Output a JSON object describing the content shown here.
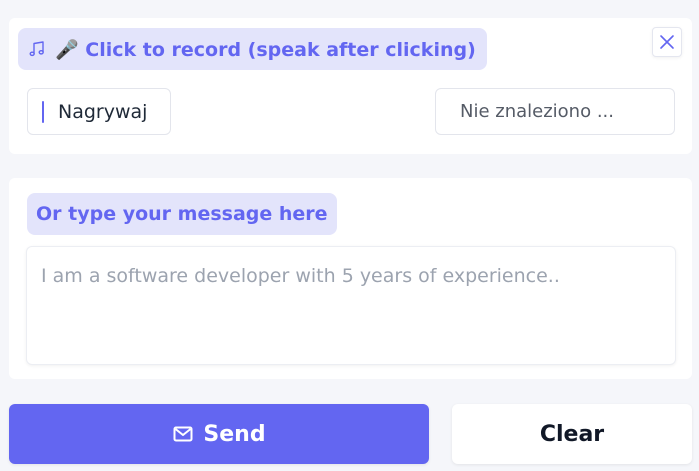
{
  "colors": {
    "accent": "#6366f1",
    "pill_background": "#e3e4fb",
    "page_background": "#f5f6fa",
    "panel_background": "#ffffff"
  },
  "record": {
    "label": "🎤 Click to record (speak after clicking)",
    "note_icon": "music-note-icon",
    "close_icon": "close-icon",
    "status_text": "Nagrywaj",
    "device_select_value": "Nie znaleziono ..."
  },
  "message": {
    "label": "Or type your message here",
    "value": "",
    "placeholder": "I am a software developer with 5 years of experience.."
  },
  "actions": {
    "send_label": "Send",
    "send_icon": "mail-icon",
    "clear_label": "Clear"
  }
}
